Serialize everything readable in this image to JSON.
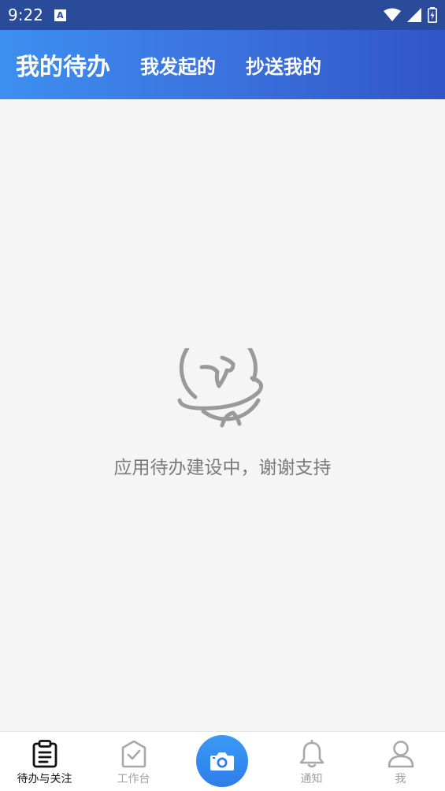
{
  "status_bar": {
    "time": "9:22",
    "notification_glyph": "A"
  },
  "header": {
    "tabs": [
      {
        "label": "我的待办",
        "active": true
      },
      {
        "label": "我发起的",
        "active": false
      },
      {
        "label": "抄送我的",
        "active": false
      }
    ]
  },
  "empty_state": {
    "icon": "planet-icon",
    "message": "应用待办建设中，谢谢支持"
  },
  "bottom_nav": {
    "items": [
      {
        "label": "待办与关注",
        "icon": "clipboard-icon",
        "active": true
      },
      {
        "label": "工作台",
        "icon": "shield-check-icon",
        "active": false
      },
      {
        "label": "",
        "icon": "camera-icon",
        "active": false
      },
      {
        "label": "通知",
        "icon": "bell-icon",
        "active": false
      },
      {
        "label": "我",
        "icon": "user-icon",
        "active": false
      }
    ]
  },
  "colors": {
    "header_start": "#3d8ff0",
    "header_end": "#3055c6",
    "status_bar": "#2a4a9a",
    "camera_button": "#2f7de8",
    "active_nav_text": "#111111",
    "inactive_nav_text": "#a0a0a0"
  }
}
